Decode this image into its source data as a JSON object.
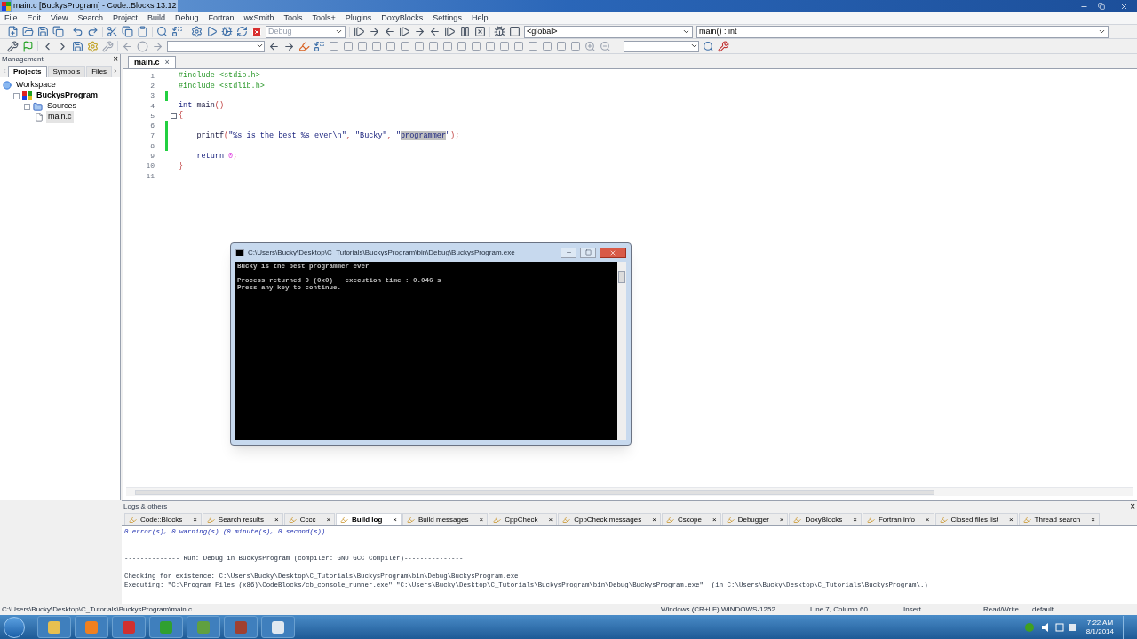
{
  "window": {
    "title": "main.c [BuckysProgram] - Code::Blocks 13.12"
  },
  "menu": [
    "File",
    "Edit",
    "View",
    "Search",
    "Project",
    "Build",
    "Debug",
    "Fortran",
    "wxSmith",
    "Tools",
    "Tools+",
    "Plugins",
    "DoxyBlocks",
    "Settings",
    "Help"
  ],
  "toolbar": {
    "build_target": "Debug",
    "scope": "<global>",
    "symbol": "main() : int"
  },
  "management": {
    "title": "Management",
    "close": "×",
    "tabs": [
      {
        "label": "Projects",
        "selected": true
      },
      {
        "label": "Symbols",
        "selected": false
      },
      {
        "label": "Files",
        "selected": false
      }
    ],
    "tree": [
      {
        "label": "Workspace",
        "kind": "workspace",
        "selected": false,
        "children": [
          {
            "label": "BuckysProgram",
            "kind": "project",
            "selected": false,
            "children": [
              {
                "label": "Sources",
                "kind": "folder",
                "selected": false,
                "children": [
                  {
                    "label": "main.c",
                    "kind": "file",
                    "selected": true
                  }
                ]
              }
            ]
          }
        ]
      }
    ]
  },
  "editor": {
    "tabs": [
      {
        "label": "main.c",
        "close": "×",
        "selected": true
      }
    ],
    "lines": [
      {
        "number": "1",
        "changed": false,
        "fold": false,
        "tokens": [
          {
            "text": "#include <stdio.h>",
            "kind": "preproc"
          }
        ]
      },
      {
        "number": "2",
        "changed": false,
        "fold": false,
        "tokens": [
          {
            "text": "#include <stdlib.h>",
            "kind": "preproc"
          }
        ]
      },
      {
        "number": "3",
        "changed": true,
        "fold": false
      },
      {
        "number": "4",
        "changed": false,
        "fold": false,
        "tokens": [
          {
            "text": "int",
            "kind": "keyword"
          },
          {
            "text": " main",
            "kind": "plain"
          },
          {
            "text": "()",
            "kind": "brace"
          }
        ]
      },
      {
        "number": "5",
        "changed": false,
        "fold": true,
        "tokens": [
          {
            "text": "{",
            "kind": "brace"
          }
        ]
      },
      {
        "number": "6",
        "changed": true,
        "fold": false
      },
      {
        "number": "7",
        "changed": true,
        "fold": false,
        "tokens": [
          {
            "text": "    printf",
            "kind": "plain"
          },
          {
            "text": "(",
            "kind": "brace"
          },
          {
            "text": "\"%s is the best %s ever\\n\"",
            "kind": "string"
          },
          {
            "text": ", ",
            "kind": "brace"
          },
          {
            "text": "\"Bucky\"",
            "kind": "string"
          },
          {
            "text": ", ",
            "kind": "brace"
          },
          {
            "text": "\"",
            "kind": "string"
          },
          {
            "text": "programmer",
            "kind": "selected"
          },
          {
            "text": "\"",
            "kind": "string"
          },
          {
            "text": ");",
            "kind": "brace"
          }
        ]
      },
      {
        "number": "8",
        "changed": true,
        "fold": false
      },
      {
        "number": "9",
        "changed": false,
        "fold": false,
        "tokens": [
          {
            "text": "    return",
            "kind": "keyword"
          },
          {
            "text": " 0",
            "kind": "number"
          },
          {
            "text": ";",
            "kind": "brace"
          }
        ]
      },
      {
        "number": "10",
        "changed": false,
        "fold": false,
        "tokens": [
          {
            "text": "}",
            "kind": "brace"
          }
        ]
      },
      {
        "number": "11",
        "changed": false,
        "fold": false
      }
    ]
  },
  "console": {
    "title": "C:\\Users\\Bucky\\Desktop\\C_Tutorials\\BuckysProgram\\bin\\Debug\\BuckysProgram.exe",
    "lines": [
      {
        "text": "Bucky is the best programmer ever",
        "kind": "output"
      },
      {
        "kind": "blank"
      },
      {
        "kind": "output",
        "text": "Process returned 0 (0x0)   execution time : 0.046 s"
      },
      {
        "text": "Press any key to continue.",
        "kind": "output"
      }
    ]
  },
  "logs": {
    "title": "Logs & others",
    "close": "×",
    "tabs": [
      {
        "label": "Code::Blocks",
        "selected": false
      },
      {
        "label": "Search results",
        "selected": false
      },
      {
        "label": "Cccc",
        "selected": false
      },
      {
        "label": "Build log",
        "selected": true
      },
      {
        "label": "Build messages",
        "selected": false
      },
      {
        "label": "CppCheck",
        "selected": false
      },
      {
        "label": "CppCheck messages",
        "selected": false
      },
      {
        "label": "Cscope",
        "selected": false
      },
      {
        "label": "Debugger",
        "selected": false
      },
      {
        "label": "DoxyBlocks",
        "selected": false
      },
      {
        "label": "Fortran info",
        "selected": false
      },
      {
        "label": "Closed files list",
        "selected": false
      },
      {
        "label": "Thread search",
        "selected": false
      }
    ],
    "tab_close": "×",
    "lines": [
      {
        "text": "0 error(s), 0 warning(s) (0 minute(s), 0 second(s))",
        "kind": "summary"
      },
      {
        "kind": "blank"
      },
      {
        "kind": "blank"
      },
      {
        "text": "-------------- Run: Debug in BuckysProgram (compiler: GNU GCC Compiler)---------------",
        "kind": "plain"
      },
      {
        "kind": "blank"
      },
      {
        "text": "Checking for existence: C:\\Users\\Bucky\\Desktop\\C_Tutorials\\BuckysProgram\\bin\\Debug\\BuckysProgram.exe",
        "kind": "plain"
      },
      {
        "text": "Executing: \"C:\\Program Files (x86)\\CodeBlocks/cb_console_runner.exe\" \"C:\\Users\\Bucky\\Desktop\\C_Tutorials\\BuckysProgram\\bin\\Debug\\BuckysProgram.exe\"  (in C:\\Users\\Bucky\\Desktop\\C_Tutorials\\BuckysProgram\\.)",
        "kind": "plain"
      }
    ]
  },
  "status_bar": {
    "path": "C:\\Users\\Bucky\\Desktop\\C_Tutorials\\BuckysProgram\\main.c",
    "fields": [
      "Windows (CR+LF)",
      "WINDOWS-1252",
      "Line 7, Column 60",
      "Insert",
      "Read/Write",
      "default"
    ]
  },
  "taskbar": {
    "time": "7:22 AM",
    "date": "8/1/2014"
  }
}
